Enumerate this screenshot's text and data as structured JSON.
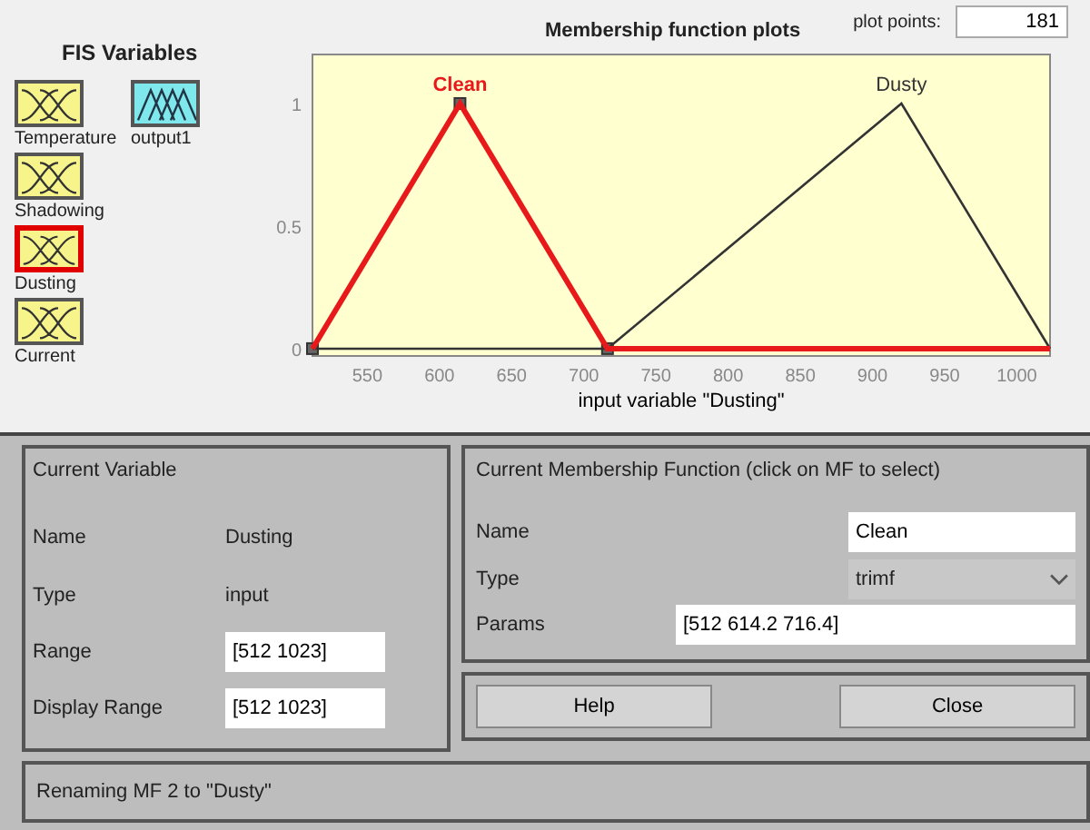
{
  "fis_variables": {
    "title": "FIS Variables",
    "items": [
      {
        "label": "Temperature",
        "kind": "input",
        "selected": false
      },
      {
        "label": "output1",
        "kind": "output",
        "selected": false
      },
      {
        "label": "Shadowing",
        "kind": "input",
        "selected": false
      },
      {
        "label": "Dusting",
        "kind": "input",
        "selected": true
      },
      {
        "label": "Current",
        "kind": "input",
        "selected": false
      }
    ]
  },
  "plot": {
    "plot_points_label": "plot points:",
    "plot_points": "181",
    "chart_data": {
      "type": "line",
      "title": "Membership function plots",
      "xlabel": "input variable \"Dusting\"",
      "x": [
        512,
        614.2,
        716.4,
        920,
        1023
      ],
      "series": [
        {
          "name": "Clean",
          "color": "#e8191b",
          "values": [
            0,
            1,
            0,
            0,
            0
          ]
        },
        {
          "name": "Dusty",
          "color": "#333333",
          "values": [
            0,
            0,
            0,
            1,
            0
          ]
        }
      ],
      "xlim": [
        512,
        1023
      ],
      "ylim": [
        -0.03,
        1.2
      ],
      "xticks": [
        550,
        600,
        650,
        700,
        750,
        800,
        850,
        900,
        950,
        1000
      ],
      "yticks": [
        0,
        0.5,
        1
      ]
    },
    "membership_functions": [
      {
        "selected": true
      },
      {
        "selected": false
      }
    ]
  },
  "current_variable": {
    "title": "Current Variable",
    "rows": [
      {
        "label": "Name",
        "value": "Dusting",
        "kind": "text"
      },
      {
        "label": "Type",
        "value": "input",
        "kind": "text"
      },
      {
        "label": "Range",
        "value": "[512 1023]",
        "kind": "field"
      },
      {
        "label": "Display Range",
        "value": "[512 1023]",
        "kind": "field"
      }
    ]
  },
  "current_mf": {
    "title": "Current Membership Function (click on MF to select)",
    "name_label": "Name",
    "name": "Clean",
    "type_label": "Type",
    "type": "trimf",
    "params_label": "Params",
    "params": "[512 614.2 716.4]"
  },
  "buttons": [
    "Help",
    "Close"
  ],
  "status_bar": "Renaming MF 2 to \"Dusty\""
}
